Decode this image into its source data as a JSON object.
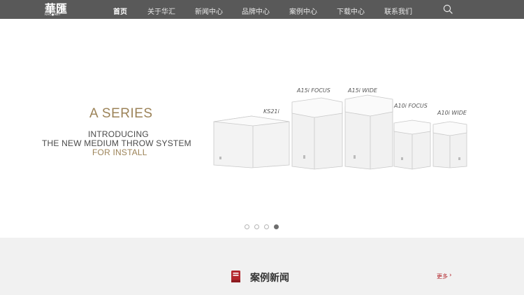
{
  "header": {
    "logo_main": "華匯",
    "logo_sub": "RAC●NET",
    "nav": [
      {
        "label": "首页",
        "active": true
      },
      {
        "label": "关于华汇",
        "active": false
      },
      {
        "label": "新闻中心",
        "active": false
      },
      {
        "label": "品牌中心",
        "active": false
      },
      {
        "label": "案例中心",
        "active": false
      },
      {
        "label": "下载中心",
        "active": false
      },
      {
        "label": "联系我们",
        "active": false
      }
    ],
    "search_icon": "search-icon"
  },
  "hero": {
    "title": "A SERIES",
    "line1": "INTRODUCING",
    "line2": "THE NEW MEDIUM THROW SYSTEM",
    "line3": "FOR INSTALL",
    "product_labels": [
      "KS21i",
      "A15i FOCUS",
      "A15i WIDE",
      "A10i FOCUS",
      "A10i WIDE"
    ],
    "slides_total": 4,
    "active_slide": 4,
    "accent_color": "#9c8358"
  },
  "section": {
    "title": "案例新闻",
    "more_label": "更多",
    "accent_color": "#b3262c"
  }
}
